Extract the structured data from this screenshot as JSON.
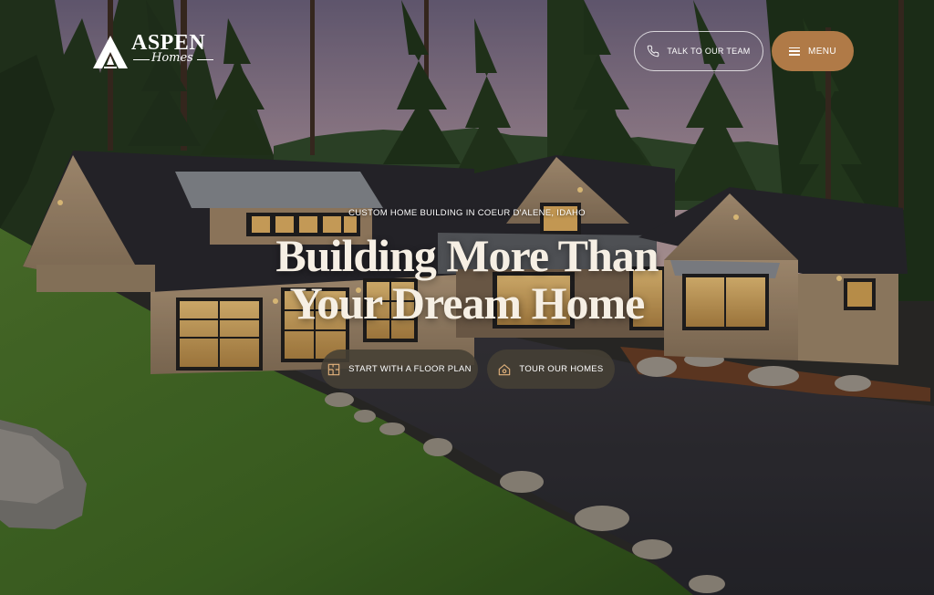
{
  "brand": {
    "name": "ASPEN",
    "sub": "Homes",
    "logo_icon": "aspen-a-mark-icon"
  },
  "header": {
    "talk_label": "TALK TO OUR TEAM",
    "talk_icon": "phone-icon",
    "menu_label": "MENU",
    "menu_icon": "hamburger-icon",
    "accent_color": "#b07a47"
  },
  "hero": {
    "eyebrow": "CUSTOM HOME BUILDING IN COEUR D'ALENE, IDAHO",
    "headline_line1": "Building More Than",
    "headline_line2": "Your Dream Home",
    "cta_primary": {
      "label": "START WITH A FLOOR PLAN",
      "icon": "floor-plan-icon"
    },
    "cta_secondary": {
      "label": "TOUR OUR HOMES",
      "icon": "home-icon"
    },
    "button_color": "#464034"
  }
}
